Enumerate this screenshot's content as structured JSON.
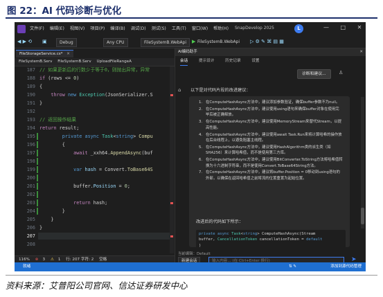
{
  "figure": {
    "title": "图 22：AI 代码诊断与优化",
    "source": "资料来源：艾普阳公司官网、信达证券研发中心"
  },
  "app": {
    "menu": [
      "文件(F)",
      "编辑(E)",
      "视图(V)",
      "项目(P)",
      "编译(B)",
      "调试(D)",
      "测试(S)",
      "工具(T)",
      "窗口(W)",
      "帮助(H)"
    ],
    "project_name": "SnapDevelop 2025",
    "avatar_letter": "L",
    "window_controls": [
      "—",
      "□",
      "✕"
    ],
    "toolbar": {
      "config": "Debug",
      "platform": "Any CPU",
      "project": "FileSystemB.WebApi",
      "run_target": "FileSystemB.WebApi"
    },
    "accent_color": "#3d7cf0",
    "status_bar_color": "#1f6fd1"
  },
  "editor": {
    "tab_label": "FileStorageService.cs*",
    "tab_close": "✕",
    "nav": [
      "FileSystemB.Serv",
      "FileSystemB.Serv",
      "UploadFileRangeA"
    ],
    "lines": [
      {
        "n": "187",
        "parts": [
          [
            "cm",
            "// 如果更新后的行数少于等于0，则抛出异常，异常 "
          ]
        ]
      },
      {
        "n": "188",
        "parts": [
          [
            "ctl",
            "if"
          ],
          [
            "txt",
            " (rows <= "
          ],
          [
            "nm",
            "0"
          ],
          [
            "txt",
            ")"
          ]
        ]
      },
      {
        "n": "189",
        "parts": [
          [
            "txt",
            "{"
          ]
        ]
      },
      {
        "n": "190",
        "parts": [
          [
            "txt",
            "    "
          ],
          [
            "ctl",
            "throw"
          ],
          [
            "txt",
            " "
          ],
          [
            "kw",
            "new"
          ],
          [
            "txt",
            " "
          ],
          [
            "ty",
            "Exception"
          ],
          [
            "txt",
            "(JsonSerializer.S"
          ]
        ]
      },
      {
        "n": "191",
        "parts": [
          [
            "txt",
            "}"
          ]
        ]
      },
      {
        "n": "192",
        "parts": []
      },
      {
        "n": "193",
        "parts": [
          [
            "cm",
            "// 返回操作结果"
          ]
        ]
      },
      {
        "n": "194",
        "parts": [
          [
            "ctl",
            "return"
          ],
          [
            "txt",
            " result;"
          ]
        ]
      },
      {
        "n": "195",
        "parts": [
          [
            "txt",
            "        "
          ],
          [
            "kw",
            "private"
          ],
          [
            "txt",
            " "
          ],
          [
            "kw",
            "async"
          ],
          [
            "txt",
            " "
          ],
          [
            "ty",
            "Task"
          ],
          [
            "txt",
            "<"
          ],
          [
            "kw",
            "string"
          ],
          [
            "txt",
            "> "
          ],
          [
            "fn",
            "Compu"
          ]
        ]
      },
      {
        "n": "196",
        "parts": [
          [
            "txt",
            "        {"
          ]
        ]
      },
      {
        "n": "197",
        "parts": [
          [
            "txt",
            "            "
          ],
          [
            "ctl",
            "await"
          ],
          [
            "txt",
            " _xxh64."
          ],
          [
            "fn",
            "AppendAsync"
          ],
          [
            "txt",
            "(buf"
          ]
        ]
      },
      {
        "n": "198",
        "parts": []
      },
      {
        "n": "199",
        "parts": [
          [
            "txt",
            "            "
          ],
          [
            "kw",
            "var"
          ],
          [
            "txt",
            " "
          ],
          [
            "vr",
            "hash"
          ],
          [
            "txt",
            " = Convert."
          ],
          [
            "fn",
            "ToBase64S"
          ]
        ]
      },
      {
        "n": "200",
        "parts": []
      },
      {
        "n": "201",
        "parts": [
          [
            "txt",
            "            buffer."
          ],
          [
            "vr",
            "Position"
          ],
          [
            "txt",
            " = "
          ],
          [
            "nm",
            "0"
          ],
          [
            "txt",
            ";"
          ]
        ]
      },
      {
        "n": "202",
        "parts": []
      },
      {
        "n": "203",
        "parts": [
          [
            "txt",
            "            "
          ],
          [
            "ctl",
            "return"
          ],
          [
            "txt",
            " hash;"
          ]
        ]
      },
      {
        "n": "204",
        "parts": [
          [
            "txt",
            "        }"
          ]
        ]
      },
      {
        "n": "205",
        "parts": [
          [
            "txt",
            "    }"
          ]
        ]
      },
      {
        "n": "206",
        "parts": [
          [
            "txt",
            "}"
          ]
        ]
      },
      {
        "n": "207",
        "parts": []
      },
      {
        "n": "208",
        "parts": []
      }
    ],
    "current_line": "207",
    "status": {
      "zoom": "116%",
      "errors": "3",
      "warnings": "1",
      "position": "行: 207  字符: 2",
      "spaces": "空格"
    }
  },
  "ai_panel": {
    "title": "AI编码助手",
    "close": "✕",
    "tabs": [
      "会话",
      "提示设计",
      "历史记录",
      "设置"
    ],
    "diagnose_button": "诊断和建议...",
    "intro": "以下是对代码片段的改进建议：",
    "suggestions": [
      "在ComputeHashAsync方法中，建议添加参数验证，确保buffer参数不为null。",
      "在ComputeHashAsync方法中，建议使用using语句来确保buffer对象在使用完毕后被正确释放。",
      "在ComputeHashAsync方法中，建议使用MemoryStream来替代Stream，以提高性能。",
      "在ComputeHashAsync方法中，建议使用await Task.Run来将计算哈希的操作放在后台线程上，以避免阻塞主线程。",
      "在ComputeHashAsync方法中，建议使用HashAlgorithm类的派生类（如SHA256）来计算哈希值，而不是使用第三方库。",
      "在ComputeHashAsync方法中，建议使用BitConverter.ToString方法将哈希值转换为十六进制字符串，而不是使用Convert.ToBase64String方法。",
      "在ComputeHashAsync方法中，建议将buffer.Position = 0移动到using语句的外部，以确保在返回哈希值之前将流的位置重置为起始位置。"
    ],
    "code_intro": "改进后的代码如下所示：",
    "code_lines": [
      "private async Task<string> ComputeHashAsync(Stream",
      "buffer, CancellationToken cancellationToken = default",
      ")"
    ],
    "context_label": "当前编辑：Default",
    "agent": "新建会话",
    "input_placeholder": "输入内容... (在 Ctrl+Enter 换行)",
    "send_icon": "➤"
  },
  "status_bar": {
    "ready": "就绪",
    "source_control": "添加到源代码管理"
  }
}
